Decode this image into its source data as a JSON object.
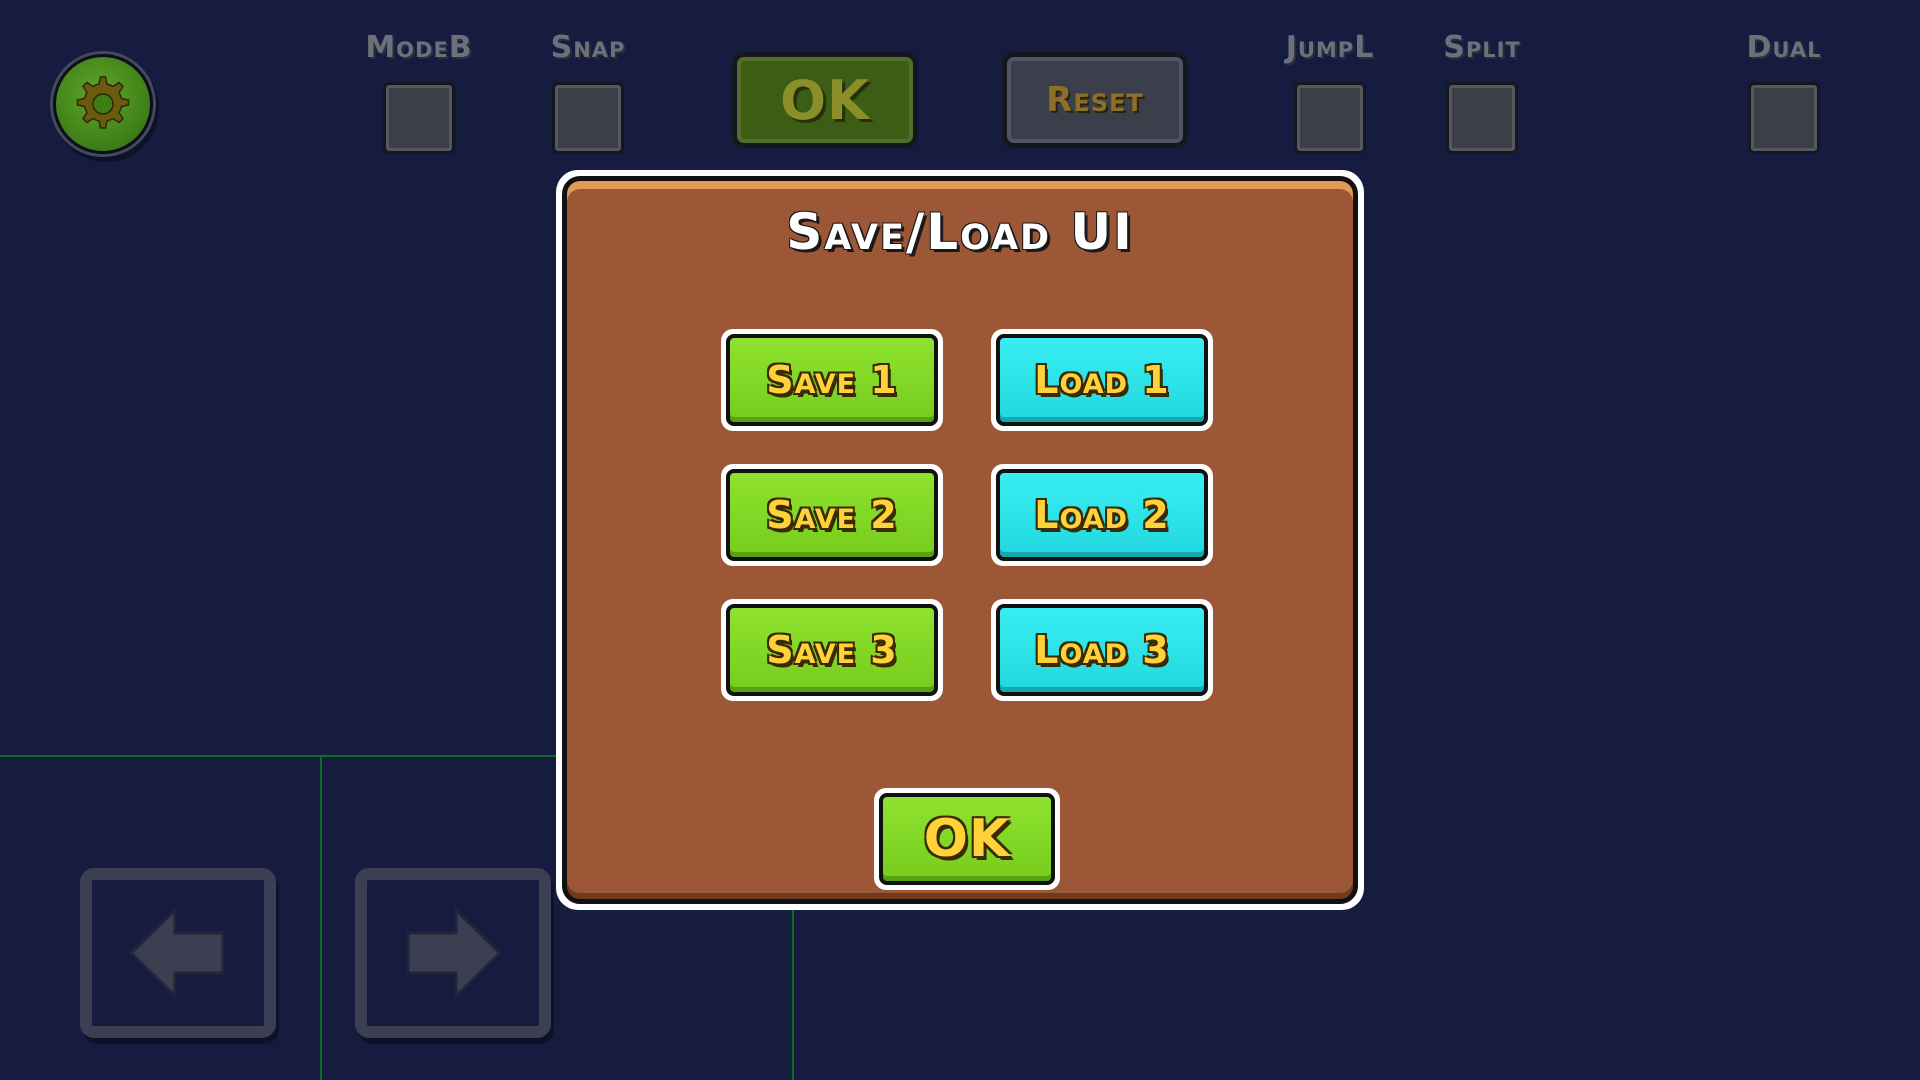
{
  "toolbar": {
    "settings_icon": "gear-icon",
    "toggles": [
      {
        "label": "ModeB",
        "checked": false
      },
      {
        "label": "Snap",
        "checked": false
      },
      {
        "label": "JumpL",
        "checked": false
      },
      {
        "label": "Split",
        "checked": false
      },
      {
        "label": "Dual",
        "checked": false
      }
    ],
    "ok_label": "OK",
    "reset_label": "Reset"
  },
  "nav": {
    "left_icon": "arrow-left-icon",
    "right_icon": "arrow-right-icon"
  },
  "dialog": {
    "title": "Save/Load UI",
    "save_buttons": [
      "Save 1",
      "Save 2",
      "Save 3"
    ],
    "load_buttons": [
      "Load 1",
      "Load 2",
      "Load 3"
    ],
    "ok_label": "OK"
  },
  "colors": {
    "background": "#161c3f",
    "dialog_fill": "#9c5836",
    "save_button": "#83d725",
    "load_button": "#2ee3e8",
    "label_text": "#ffd23a"
  }
}
